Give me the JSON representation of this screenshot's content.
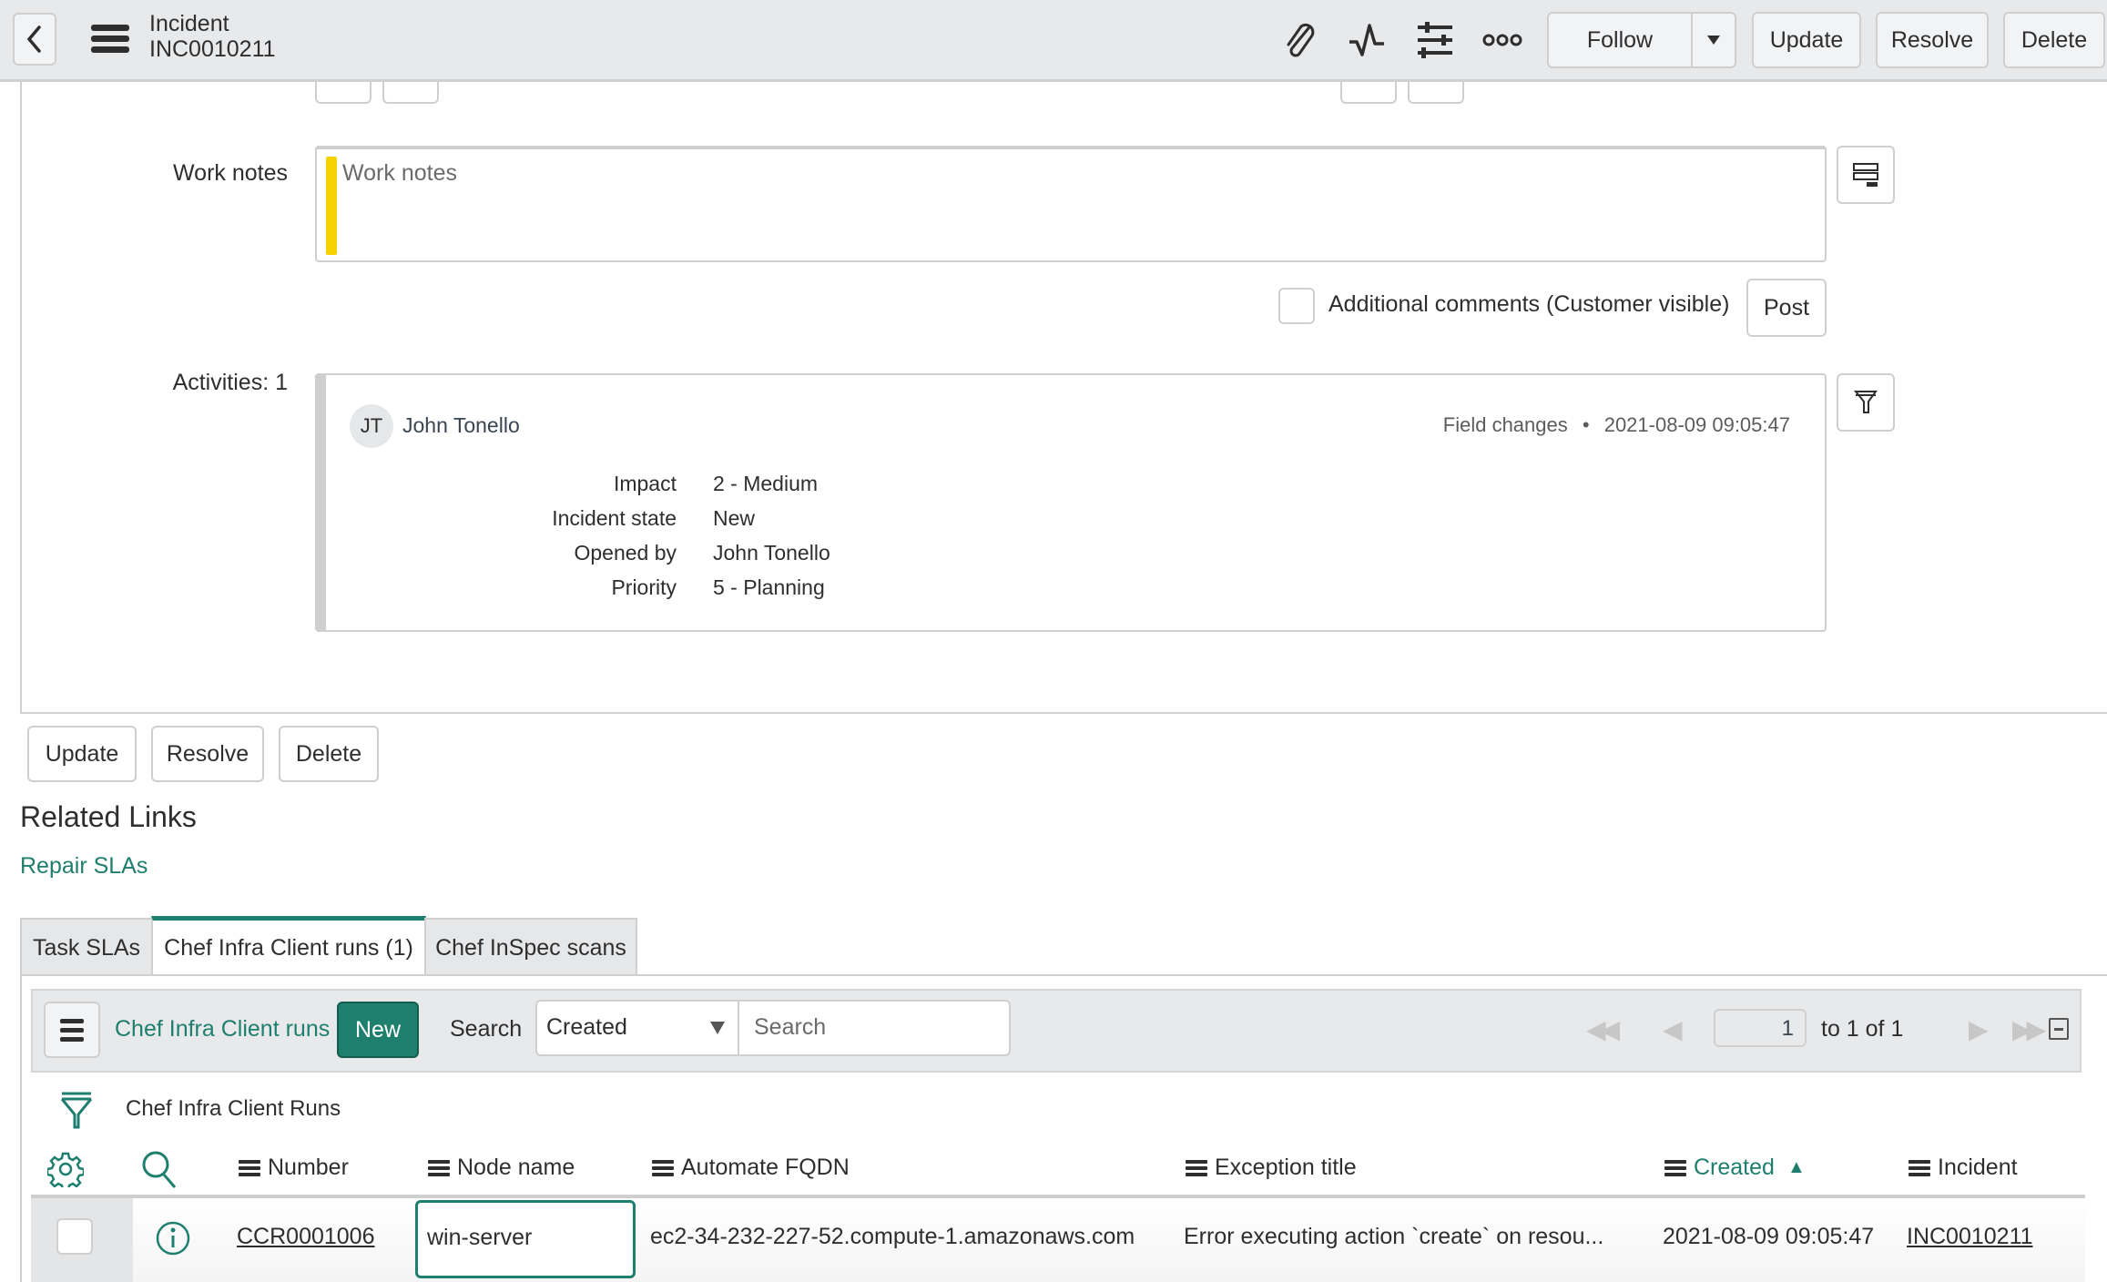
{
  "header": {
    "record_type": "Incident",
    "record_number": "INC0010211",
    "icons": [
      "paperclip-icon",
      "activity-pulse-icon",
      "sliders-icon",
      "more-icon"
    ],
    "follow_label": "Follow",
    "update_label": "Update",
    "resolve_label": "Resolve",
    "delete_label": "Delete"
  },
  "work_notes": {
    "label": "Work notes",
    "placeholder": "Work notes",
    "value": "",
    "highlight_color": "#f5d200"
  },
  "additional_comments": {
    "label": "Additional comments (Customer visible)",
    "checked": false,
    "post_label": "Post"
  },
  "activities": {
    "label": "Activities: 1",
    "entries": [
      {
        "initials": "JT",
        "user": "John Tonello",
        "type": "Field changes",
        "separator": "•",
        "timestamp": "2021-08-09 09:05:47",
        "changes": [
          {
            "field": "Impact",
            "value": "2 - Medium"
          },
          {
            "field": "Incident state",
            "value": "New"
          },
          {
            "field": "Opened by",
            "value": "John Tonello"
          },
          {
            "field": "Priority",
            "value": "5 - Planning"
          }
        ]
      }
    ]
  },
  "form_actions": {
    "update_label": "Update",
    "resolve_label": "Resolve",
    "delete_label": "Delete"
  },
  "related_links": {
    "title": "Related Links",
    "links": [
      {
        "label": "Repair SLAs"
      }
    ]
  },
  "tabs": [
    {
      "label": "Task SLAs",
      "active": false
    },
    {
      "label": "Chef Infra Client runs (1)",
      "active": true
    },
    {
      "label": "Chef InSpec scans",
      "active": false
    }
  ],
  "list": {
    "title": "Chef Infra Client runs",
    "new_label": "New",
    "search_label": "Search",
    "search_field": "Created",
    "search_placeholder": "Search",
    "page_value": "1",
    "page_text": "to 1 of 1",
    "breadcrumb_title": "Chef Infra Client Runs",
    "accent_color": "#1f7f6f",
    "columns": [
      {
        "label": "Number"
      },
      {
        "label": "Node name"
      },
      {
        "label": "Automate FQDN"
      },
      {
        "label": "Exception title"
      },
      {
        "label": "Created",
        "sort": "ascending",
        "sort_glyph": "▲"
      },
      {
        "label": "Incident"
      }
    ],
    "rows": [
      {
        "number": "CCR0001006",
        "node_name": "win-server",
        "automate_fqdn": "ec2-34-232-227-52.compute-1.amazonaws.com",
        "exception_title": "Error executing action `create` on resou...",
        "created": "2021-08-09 09:05:47",
        "incident": "INC0010211"
      }
    ]
  }
}
